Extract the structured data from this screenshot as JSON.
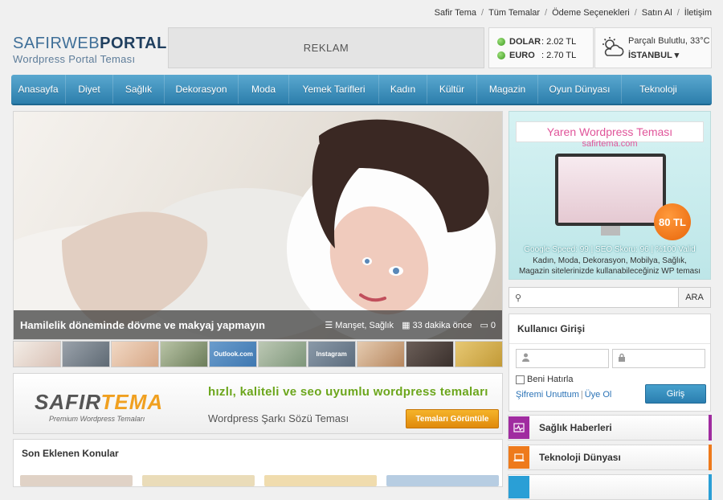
{
  "toplinks": [
    "Safir Tema",
    "Tüm Temalar",
    "Ödeme Seçenekleri",
    "Satın Al",
    "İletişim"
  ],
  "logo": {
    "part1": "SAFIR",
    "part2": "WEB",
    "part3": "PORTAL",
    "tagline": "Wordpress Portal Teması"
  },
  "ad": {
    "label": "REKLAM"
  },
  "currency": [
    {
      "name": "DOLAR",
      "value": ": 2.02 TL"
    },
    {
      "name": "EURO",
      "value": ": 2.70 TL"
    }
  ],
  "weather": {
    "desc": "Parçalı Bulutlu, 33°C",
    "city": "İSTANBUL ▾"
  },
  "nav": [
    "Anasayfa",
    "Diyet",
    "Sağlık",
    "Dekorasyon",
    "Moda",
    "Yemek Tarifleri",
    "Kadın",
    "Kültür",
    "Magazin",
    "Oyun Dünyası",
    "Teknoloji"
  ],
  "slider": {
    "title": "Hamilelik döneminde dövme ve makyaj yapmayın",
    "categories": "Manşet, Sağlık",
    "time": "33 dakika önce",
    "comments": "0"
  },
  "thumbs": [
    "",
    "",
    "",
    "",
    "Outlook.com",
    "",
    "Instagram",
    "",
    "",
    ""
  ],
  "banner": {
    "logo_a": "SAFIR",
    "logo_b": "TEMA",
    "logo_sub": "Premium Wordpress Temaları",
    "slogan": "hızlı, kaliteli ve seo uyumlu wordpress temaları",
    "sub": "Wordpress Şarkı Sözü Teması",
    "button": "Temaları Görüntüle"
  },
  "latest": {
    "title": "Son Eklenen Konular"
  },
  "sidead": {
    "ribbon": "Yaren Wordpress Teması",
    "site": "safirtema.com",
    "price": "80 TL",
    "spec": "Google Speed: 99 | SEO Skoru: 96 | %100 Valid",
    "desc1": "Kadın, Moda, Dekorasyon, Mobilya, Sağlık,",
    "desc2": "Magazin sitelerinizde kullanabileceğiniz WP teması"
  },
  "search": {
    "placeholder": "",
    "button": "ARA"
  },
  "login": {
    "title": "Kullanıcı Girişi",
    "remember": "Beni Hatırla",
    "forgot": "Şifremi Unuttum",
    "sep": "|",
    "register": "Üye Ol",
    "button": "Giriş"
  },
  "categories": [
    {
      "label": "Sağlık Haberleri",
      "color": "#a02ca0"
    },
    {
      "label": "Teknoloji Dünyası",
      "color": "#ee7a1c"
    }
  ]
}
